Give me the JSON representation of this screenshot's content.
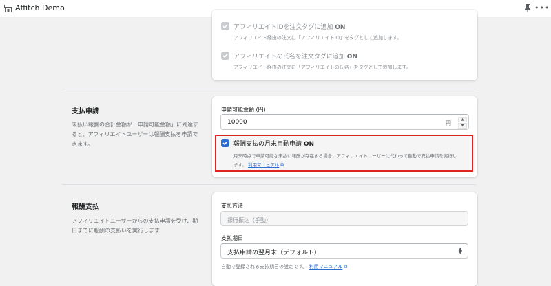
{
  "app": {
    "title": "Affitch Demo",
    "icon": "store-icon"
  },
  "topbar": {
    "pin_icon": "pin-icon",
    "more_label": "•••"
  },
  "tag_options": [
    {
      "label_pre": "アフィリエイトIDを注文タグに追加 ",
      "label_on": "ON",
      "help": "アフィリエイト経由の注文に「アフィリエイトID」をタグとして追加します。",
      "checked": true,
      "disabled": true
    },
    {
      "label_pre": "アフィリエイトの氏名を注文タグに追加 ",
      "label_on": "ON",
      "help": "アフィリエイト経由の注文に「アフィリエイトの氏名」をタグとして追加します。",
      "checked": true,
      "disabled": true
    }
  ],
  "payout_request": {
    "title": "支払申請",
    "description": "未払い報酬の合計金額が「申請可能金額」に到達すると、アフィリエイトユーザーは報酬支払を申請できます。",
    "amount_label": "申請可能金額 (円)",
    "amount_value": "10000",
    "amount_suffix": "円",
    "auto_label_pre": "報酬支払の月末自動申請 ",
    "auto_label_on": "ON",
    "auto_checked": true,
    "auto_help_line1": "月末時点で申請可能な未払い報酬が存在する場合、アフィリエイトユーザーに代わって自動で支払申請を実行し",
    "auto_help_line2": "ます。",
    "auto_help_link": "利用マニュアル"
  },
  "payout": {
    "title": "報酬支払",
    "description": "アフィリエイトユーザーからの支払申請を受け、期日までに報酬の支払いを実行します",
    "method_label": "支払方法",
    "method_placeholder": "銀行振込（手動）",
    "due_label": "支払期日",
    "due_value": "支払申請の翌月末（デフォルト）",
    "due_help": "自動で登録される支払期日の設定です。",
    "due_help_link": "利用マニュアル"
  },
  "colors": {
    "accent": "#2c6ecb",
    "highlight": "#e02424",
    "background": "#f1f1f1"
  }
}
